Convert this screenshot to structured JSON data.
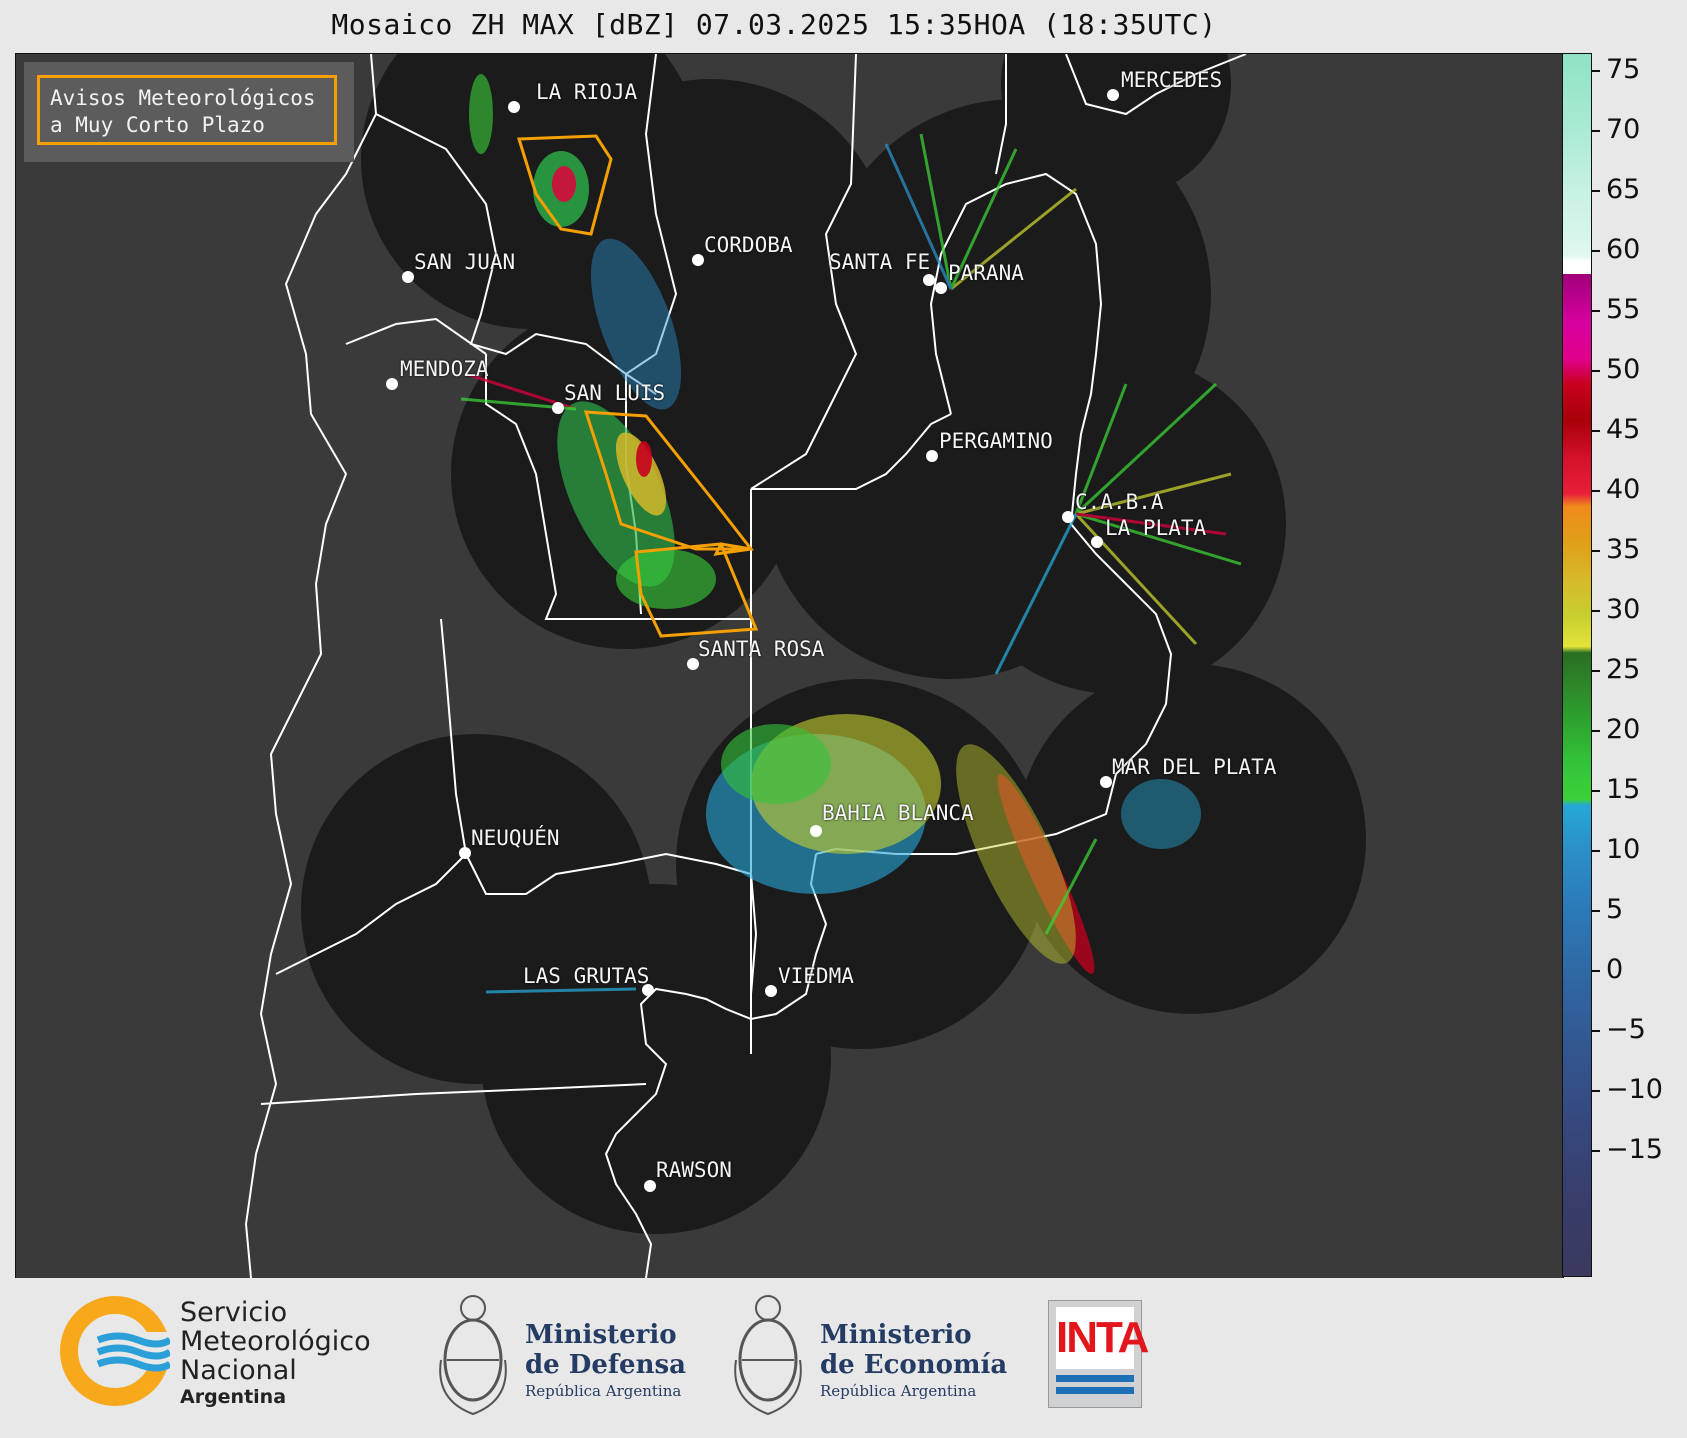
{
  "title": "Mosaico ZH MAX [dBZ] 07.03.2025 15:35HOA (18:35UTC)",
  "legend": {
    "line1": "Avisos Meteorológicos",
    "line2": "a Muy Corto Plazo",
    "warning_color": "#f5a000"
  },
  "cities": [
    {
      "name": "LA RIOJA"
    },
    {
      "name": "MERCEDES"
    },
    {
      "name": "CORDOBA"
    },
    {
      "name": "SAN JUAN"
    },
    {
      "name": "SANTA FE"
    },
    {
      "name": "PARANA"
    },
    {
      "name": "MENDOZA"
    },
    {
      "name": "SAN LUIS"
    },
    {
      "name": "PERGAMINO"
    },
    {
      "name": "C.A.B.A"
    },
    {
      "name": "LA PLATA"
    },
    {
      "name": "SANTA ROSA"
    },
    {
      "name": "MAR DEL PLATA"
    },
    {
      "name": "BAHIA BLANCA"
    },
    {
      "name": "NEUQUÉN"
    },
    {
      "name": "LAS GRUTAS"
    },
    {
      "name": "VIEDMA"
    },
    {
      "name": "RAWSON"
    }
  ],
  "colorbar": {
    "unit": "dBZ",
    "ticks": [
      "75",
      "70",
      "65",
      "60",
      "55",
      "50",
      "45",
      "40",
      "35",
      "30",
      "25",
      "20",
      "15",
      "10",
      "5",
      "0",
      "−5",
      "−10",
      "−15"
    ],
    "range": [
      -18.5,
      76.5
    ]
  },
  "footer": {
    "smn": {
      "line1": "Servicio",
      "line2": "Meteorológico",
      "line3": "Nacional",
      "line4": "Argentina"
    },
    "defensa": {
      "line1": "Ministerio",
      "line2": "de Defensa",
      "line3": "República Argentina"
    },
    "economia": {
      "line1": "Ministerio",
      "line2": "de Economía",
      "line3": "República Argentina"
    },
    "inta": {
      "label": "INTA"
    }
  },
  "colors": {
    "map_background": "#3a3a3a",
    "radar_disc": "#1b1b1b",
    "borders": "#ffffff"
  }
}
